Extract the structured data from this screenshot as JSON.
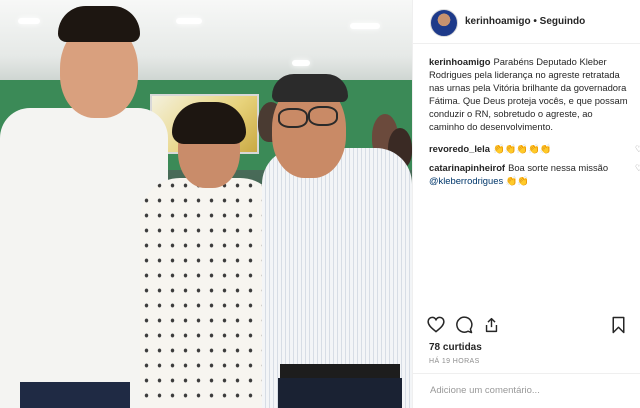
{
  "header": {
    "username": "kerinhoamigo",
    "separator": "•",
    "follow_status": "Seguindo"
  },
  "caption": {
    "username": "kerinhoamigo",
    "text": "Parabéns Deputado Kleber Rodrigues pela liderança no agreste retratada nas urnas pela Vitória brilhante da governadora Fátima. Que Deus proteja vocês, e que possam conduzir o RN, sobretudo o agreste, ao caminho do desenvolvimento."
  },
  "comments": [
    {
      "username": "revoredo_lela",
      "text": "👏👏👏👏👏"
    },
    {
      "username": "catarinapinheirof",
      "text": "Boa sorte nessa missão",
      "mention": "@kleberrodrigues",
      "emoji": "👏👏"
    }
  ],
  "icons": {
    "like": "heart-outline",
    "comment": "speech-bubble",
    "share": "share-arrow",
    "save": "bookmark",
    "comment_like": "small-heart"
  },
  "likes": "78 curtidas",
  "timestamp": "HÁ 19 HORAS",
  "add_comment": {
    "placeholder": "Adicione um comentário..."
  },
  "colors": {
    "link": "#00376b",
    "meta": "#8e8e8e",
    "border": "#efefef"
  }
}
